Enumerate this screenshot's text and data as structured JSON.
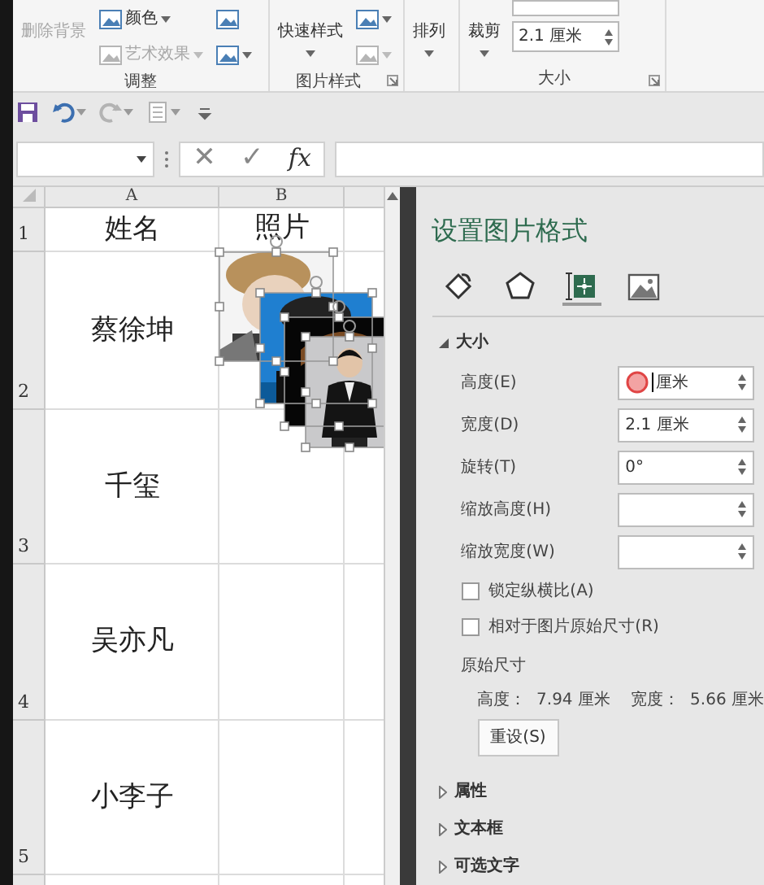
{
  "ribbon": {
    "groups": [
      {
        "label": "调整",
        "items": [
          {
            "kind": "large",
            "label": "删除背景",
            "disabled": true
          },
          {
            "kind": "stack",
            "entries": [
              {
                "kind": "button",
                "label": "颜色",
                "disabled": false,
                "dropdown": true
              },
              {
                "kind": "button",
                "label": "艺术效果",
                "disabled": true,
                "dropdown": true
              }
            ]
          },
          {
            "kind": "stack",
            "entries": [
              {
                "kind": "icon",
                "disabled": false
              },
              {
                "kind": "icon",
                "disabled": false,
                "dropdown": true
              }
            ]
          }
        ]
      },
      {
        "label": "图片样式",
        "launcher": true,
        "items": [
          {
            "kind": "large",
            "label": "快速样式",
            "disabled": false,
            "dropdown": true
          },
          {
            "kind": "stack",
            "entries": [
              {
                "kind": "icon",
                "disabled": false,
                "dropdown": true
              },
              {
                "kind": "icon",
                "disabled": true,
                "dropdown": true
              }
            ]
          }
        ]
      },
      {
        "items": [
          {
            "kind": "large",
            "label": "排列",
            "disabled": false,
            "dropdown": true
          }
        ]
      },
      {
        "label": "大小",
        "launcher": true,
        "items": [
          {
            "kind": "large",
            "label": "裁剪",
            "disabled": false,
            "dropdown": true
          },
          {
            "kind": "stack",
            "entries": [
              {
                "kind": "spin"
              },
              {
                "kind": "spin",
                "value": "2.1 厘米"
              }
            ]
          }
        ]
      }
    ]
  },
  "quick_access": [
    {
      "kind": "save",
      "disabled": false
    },
    {
      "kind": "undo",
      "disabled": false,
      "dropdown": true
    },
    {
      "kind": "redo",
      "disabled": true,
      "dropdown": true
    },
    {
      "kind": "form",
      "disabled": true,
      "dropdown": true
    },
    {
      "kind": "customize",
      "disabled": false
    }
  ],
  "formula_bar": {
    "cancel": "✕",
    "enter": "✓",
    "function": "fx"
  },
  "sheet": {
    "columns": [
      "A",
      "B"
    ],
    "rows": [
      {
        "number": "1",
        "name": "姓名",
        "photo": "照片"
      },
      {
        "number": "2",
        "name": "蔡徐坤"
      },
      {
        "number": "3",
        "name": "千玺"
      },
      {
        "number": "4",
        "name": "吴亦凡"
      },
      {
        "number": "5",
        "name": "小李子"
      }
    ],
    "pictures": [
      {
        "kind": "picture",
        "selected": true
      },
      {
        "kind": "picture",
        "selected": true
      },
      {
        "kind": "picture",
        "selected": true
      },
      {
        "kind": "picture",
        "selected": true
      }
    ]
  },
  "pane": {
    "title": "设置图片格式",
    "tabs": [
      {
        "kind": "fill",
        "selected": false
      },
      {
        "kind": "effects",
        "selected": false
      },
      {
        "kind": "size",
        "selected": true
      },
      {
        "kind": "picture",
        "selected": false
      }
    ],
    "section": {
      "label": "大小",
      "expanded": true,
      "fields": [
        {
          "label": "高度(E)",
          "value": "厘米",
          "clicked": true
        },
        {
          "label": "宽度(D)",
          "value": "2.1 厘米"
        },
        {
          "label": "旋转(T)",
          "value": "0°"
        },
        {
          "label": "缩放高度(H)"
        },
        {
          "label": "缩放宽度(W)"
        }
      ],
      "checkboxes": [
        {
          "label": "锁定纵横比(A)",
          "checked": false
        },
        {
          "label": "相对于图片原始尺寸(R)",
          "checked": false
        }
      ],
      "original_heading": "原始尺寸",
      "original_size": "高度：  7.94 厘米    宽度：  5.66 厘米",
      "reset_button": "重设(S)"
    },
    "collapsed_sections": [
      {
        "label": "属性",
        "expanded": false
      },
      {
        "label": "文本框",
        "expanded": false
      },
      {
        "label": "可选文字",
        "expanded": false
      }
    ]
  }
}
